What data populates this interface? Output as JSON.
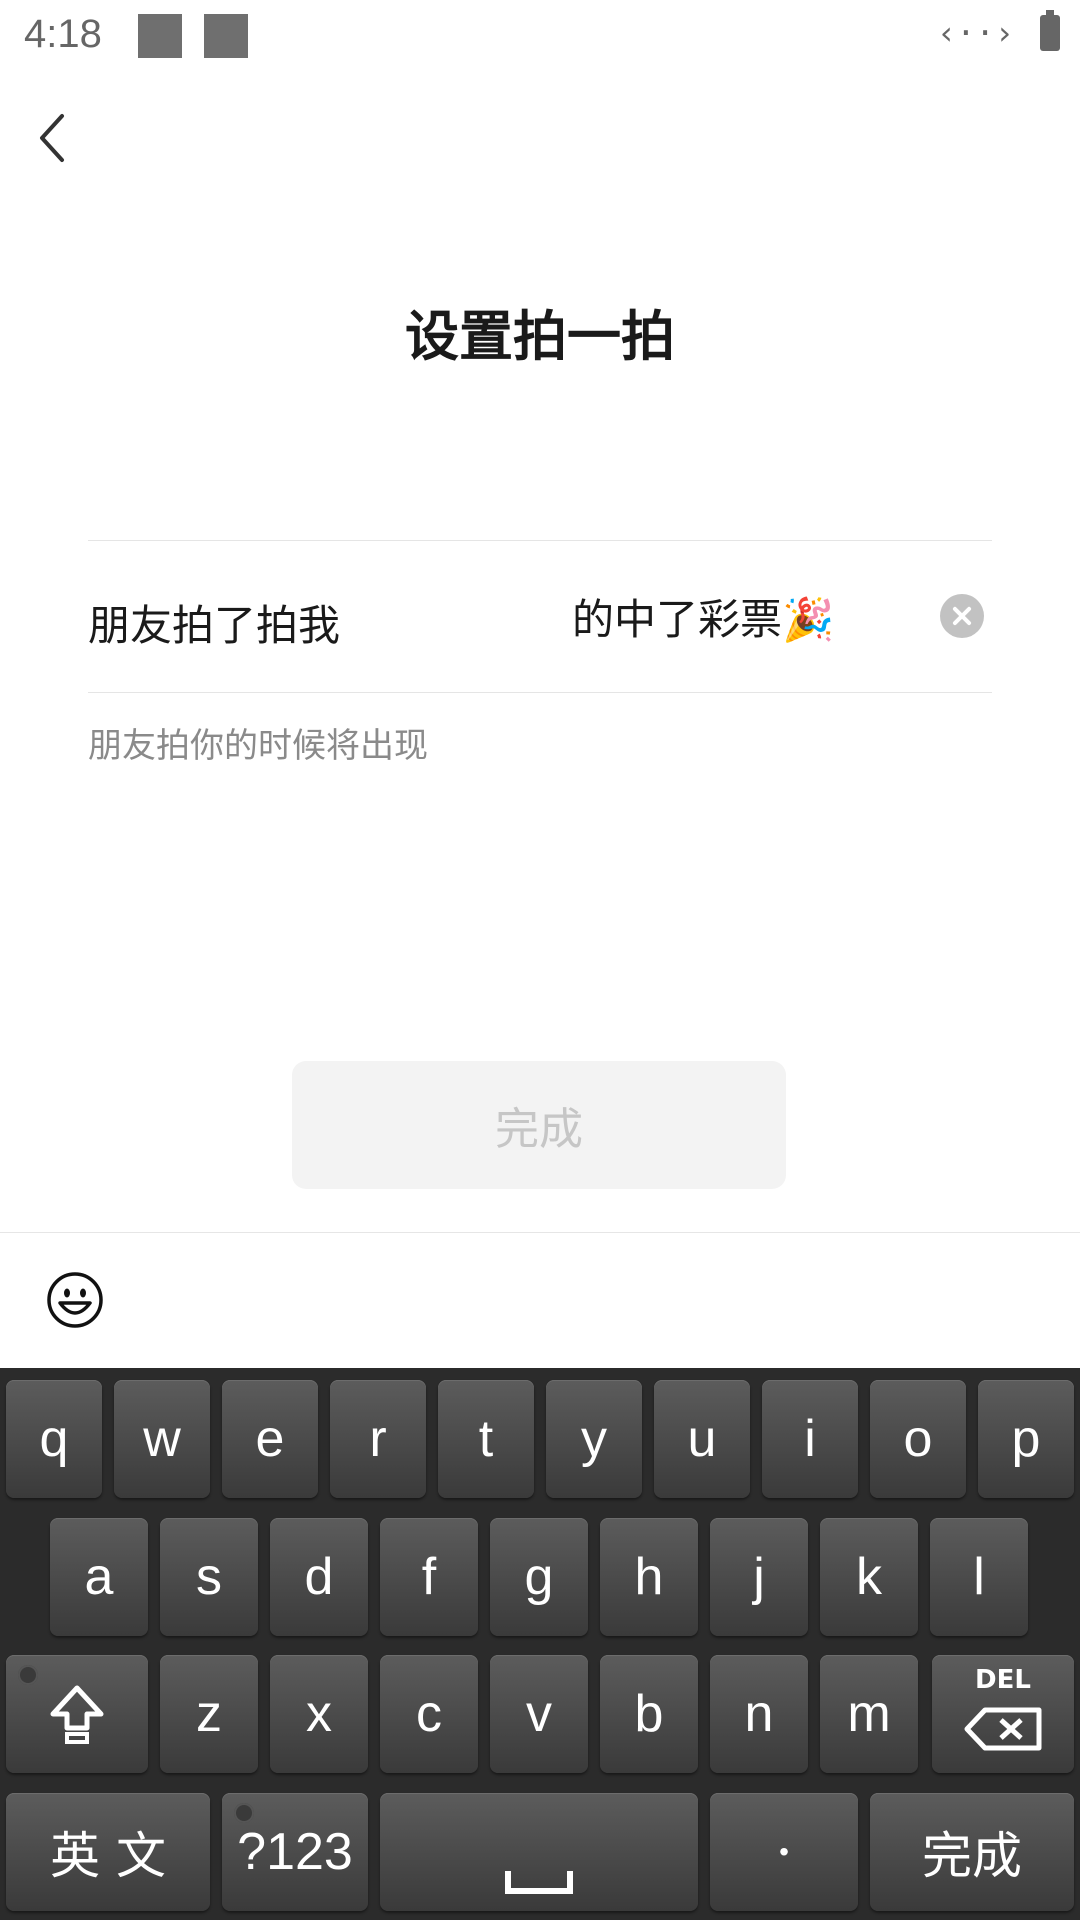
{
  "status_bar": {
    "time": "4:18"
  },
  "page": {
    "title": "设置拍一拍"
  },
  "input": {
    "prefix": "朋友拍了拍我",
    "value": "的中了彩票🎉",
    "hint": "朋友拍你的时候将出现"
  },
  "done_button": {
    "label": "完成"
  },
  "icons": {
    "back": "back-arrow-icon",
    "clear": "clear-icon",
    "emoji": "smiley-emoji-icon",
    "shift": "shift-arrow-icon",
    "delete": "backspace-icon",
    "space": "space-bar-icon",
    "link": "connection-icon",
    "battery": "battery-icon"
  },
  "keyboard": {
    "row1": [
      "q",
      "w",
      "e",
      "r",
      "t",
      "y",
      "u",
      "i",
      "o",
      "p"
    ],
    "row2": [
      "a",
      "s",
      "d",
      "f",
      "g",
      "h",
      "j",
      "k",
      "l"
    ],
    "row3": [
      "z",
      "x",
      "c",
      "v",
      "b",
      "n",
      "m"
    ],
    "del_label": "DEL",
    "lang_label": "英 文",
    "symbols_label": "?123",
    "period_label": "•",
    "done_label": "完成"
  }
}
